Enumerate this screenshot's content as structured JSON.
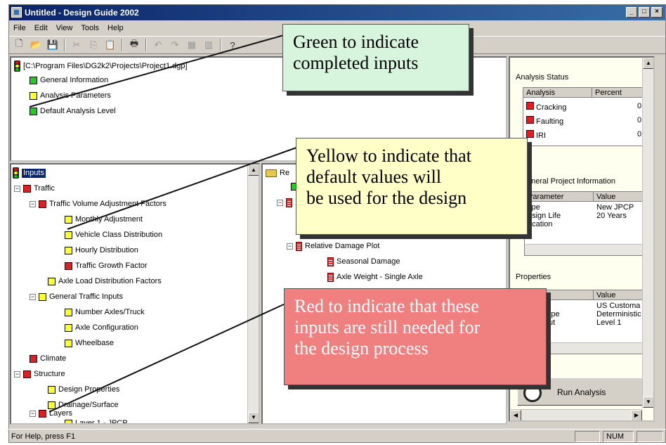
{
  "window": {
    "title": "Untitled - Design Guide 2002",
    "controls": [
      "_",
      "□",
      "×"
    ]
  },
  "menu": [
    "File",
    "Edit",
    "View",
    "Tools",
    "Help"
  ],
  "project_tree": {
    "path": "[C:\\Program Files\\DG2k2\\Projects\\Project1.dgp]",
    "items": [
      {
        "label": "General Information",
        "status": "green"
      },
      {
        "label": "Analysis Parameters",
        "status": "yellow"
      },
      {
        "label": "Default Analysis Level",
        "status": "green"
      }
    ]
  },
  "inputs_tree": {
    "root": "Inputs",
    "items": [
      {
        "label": "Traffic",
        "status": "red"
      },
      {
        "label": "Traffic Volume Adjustment Factors",
        "status": "red"
      },
      {
        "label": "Monthly Adjustment",
        "status": "yellow"
      },
      {
        "label": "Vehicle Class Distribution",
        "status": "yellow"
      },
      {
        "label": "Hourly Distribution",
        "status": "yellow"
      },
      {
        "label": "Traffic Growth Factor",
        "status": "red"
      },
      {
        "label": "Axle Load Distribution Factors",
        "status": "yellow"
      },
      {
        "label": "General Traffic Inputs",
        "status": "yellow"
      },
      {
        "label": "Number Axles/Truck",
        "status": "yellow"
      },
      {
        "label": "Axle Configuration",
        "status": "yellow"
      },
      {
        "label": "Wheelbase",
        "status": "yellow"
      },
      {
        "label": "Climate",
        "status": "red"
      },
      {
        "label": "Structure",
        "status": "red"
      },
      {
        "label": "Design Properties",
        "status": "yellow"
      },
      {
        "label": "Drainage/Surface",
        "status": "yellow"
      },
      {
        "label": "Layers",
        "status": "red"
      },
      {
        "label": "Layer 1 - JPCP",
        "status": "yellow"
      }
    ]
  },
  "results_tree": {
    "root": "Re",
    "items": [
      {
        "label": "Relative Damage Plot"
      },
      {
        "label": "Seasonal Damage"
      },
      {
        "label": "Axle Weight - Single Axle"
      }
    ]
  },
  "right_panel": {
    "analysis_status": {
      "heading": "Analysis Status",
      "columns": [
        "Analysis",
        "Percent"
      ],
      "rows": [
        {
          "label": "Cracking",
          "value": "0"
        },
        {
          "label": "Faulting",
          "value": "0"
        },
        {
          "label": "IRI",
          "value": "0"
        }
      ]
    },
    "general_project_info": {
      "heading": "eneral Project Information",
      "columns": [
        "Parameter",
        "Value"
      ],
      "rows": [
        {
          "label": "ype",
          "value": "New JPCP"
        },
        {
          "label": "esign Life",
          "value": "20 Years"
        },
        {
          "label": "ocation",
          "value": ""
        }
      ]
    },
    "properties": {
      "heading": "Properties",
      "columns": [
        "ing",
        "Value"
      ],
      "rows": [
        {
          "label": "s",
          "value": "US Customa"
        },
        {
          "label": "ysis Type",
          "value": "Deterministic"
        },
        {
          "label": "ult Input",
          "value": "Level 1"
        }
      ]
    },
    "run_button": "Run Analysis"
  },
  "statusbar": {
    "help": "For Help, press F1",
    "num": "NUM"
  },
  "callouts": {
    "green": [
      "Green to indicate",
      "completed inputs"
    ],
    "yellow": [
      "Yellow to indicate that",
      "default values will",
      "be used for the design"
    ],
    "red": [
      "Red to indicate that these",
      "inputs are still needed for",
      "the design process"
    ]
  },
  "colors": {
    "completed": "#22cc22",
    "default": "#ffff33",
    "needed": "#e02020",
    "callout_green_bg": "#d6f5dc",
    "callout_yellow_bg": "#ffffc8",
    "callout_red_bg": "#f08080"
  }
}
